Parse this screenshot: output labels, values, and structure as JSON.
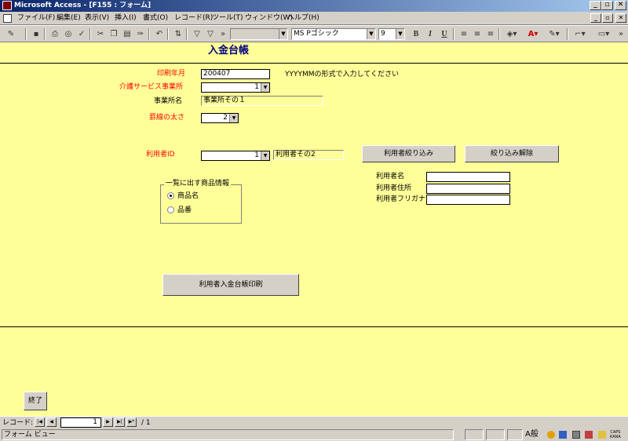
{
  "window": {
    "title": "Microsoft Access - [F155 : フォーム]",
    "min": "_",
    "max": "▫",
    "close": "✕"
  },
  "menu": {
    "items": [
      "ファイル(F)",
      "編集(E)",
      "表示(V)",
      "挿入(I)",
      "書式(O)",
      "レコード(R)",
      "ツール(T)",
      "ウィンドウ(W)",
      "ヘルプ(H)"
    ],
    "mdi_min": "_",
    "mdi_restore": "▫",
    "mdi_close": "✕"
  },
  "toolbar": {
    "icons": [
      "view-icon",
      "save-icon",
      "print-icon",
      "print-preview-icon",
      "spelling-icon",
      "cut-icon",
      "copy-icon",
      "paste-icon",
      "format-painter-icon",
      "undo-icon",
      "sort-icon",
      "filter-icon"
    ],
    "object_combo": "",
    "font_name": "MS Pゴシック",
    "font_size": "9",
    "bold": "B",
    "italic": "I",
    "underline": "U"
  },
  "form": {
    "title": "入金台帳",
    "print_month_label": "印刷年月",
    "print_month_value": "200407",
    "print_month_hint": "YYYYMMの形式で入力してください",
    "care_service_label": "介護サービス事業所",
    "care_service_value": "1",
    "office_name_label": "事業所名",
    "office_name_value": "事業所その１",
    "line_thickness_label": "罫線の太さ",
    "line_thickness_value": "2",
    "user_id_label": "利用者ID",
    "user_id_value": "1",
    "user_name_display": "利用者その2",
    "filter_button": "利用者絞り込み",
    "clear_filter_button": "絞り込み解除",
    "group_title": "一覧に出す商品情報",
    "radio_product_name": "商品名",
    "radio_product_number": "品番",
    "radio_selected": "商品名",
    "user_name_label": "利用者名",
    "user_address_label": "利用者住所",
    "user_furigana_label": "利用者フリガナ",
    "user_name_value": "",
    "user_address_value": "",
    "user_furigana_value": "",
    "print_button": "利用者入金台帳印刷",
    "close_button": "終了"
  },
  "record_nav": {
    "label": "レコード:",
    "current": "1",
    "total": "/ 1"
  },
  "status": {
    "text": "フォーム ビュー",
    "caps": "CAPS",
    "kana": "KANA",
    "ime": "A般"
  }
}
